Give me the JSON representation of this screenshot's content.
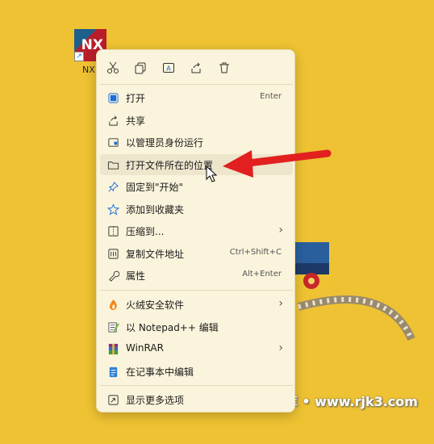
{
  "desktop": {
    "shortcut_icon_text": "NX",
    "shortcut_label": "NX",
    "watermark": "RJK3设计软件库 • www.rjk3.com"
  },
  "menu": {
    "toolbar": [
      {
        "icon": "cut-icon"
      },
      {
        "icon": "copy-icon"
      },
      {
        "icon": "rename-icon"
      },
      {
        "icon": "share-icon"
      },
      {
        "icon": "delete-icon"
      }
    ],
    "items": [
      {
        "label": "打开",
        "shortcut": "Enter",
        "icon": "open-icon"
      },
      {
        "label": "共享",
        "icon": "share-icon"
      },
      {
        "label": "以管理员身份运行",
        "icon": "admin-shield-icon"
      },
      {
        "label": "打开文件所在的位置",
        "icon": "folder-icon"
      },
      {
        "label": "固定到\"开始\"",
        "icon": "pin-icon"
      },
      {
        "label": "添加到收藏夹",
        "icon": "star-icon"
      },
      {
        "label": "压缩到...",
        "icon": "compress-icon",
        "submenu": true
      },
      {
        "label": "复制文件地址",
        "shortcut": "Ctrl+Shift+C",
        "icon": "copy-path-icon"
      },
      {
        "label": "属性",
        "shortcut": "Alt+Enter",
        "icon": "wrench-icon"
      },
      {
        "label": "火绒安全软件",
        "icon": "huorong-icon",
        "submenu": true
      },
      {
        "label": "以 Notepad++ 编辑",
        "icon": "notepadpp-icon"
      },
      {
        "label": "WinRAR",
        "icon": "winrar-icon",
        "submenu": true
      },
      {
        "label": "在记事本中编辑",
        "icon": "notepad-icon"
      },
      {
        "label": "显示更多选项",
        "icon": "more-options-icon"
      }
    ]
  },
  "colors": {
    "desktop_bg": "#eec232",
    "menu_bg": "#fbf4dc",
    "accent_blue": "#1a6fd6",
    "arrow_red": "#e2201f"
  }
}
